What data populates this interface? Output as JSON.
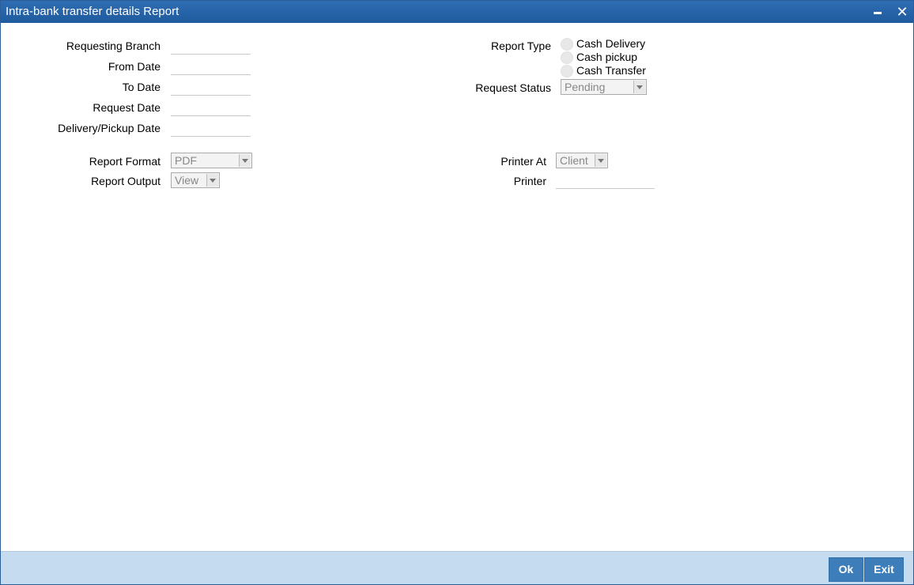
{
  "window": {
    "title": "Intra-bank transfer details Report",
    "minimize_label": "",
    "close_label": "✕"
  },
  "form": {
    "requesting_branch": {
      "label": "Requesting Branch",
      "value": ""
    },
    "from_date": {
      "label": "From Date",
      "value": ""
    },
    "to_date": {
      "label": "To Date",
      "value": ""
    },
    "request_date": {
      "label": "Request Date",
      "value": ""
    },
    "delivery_pickup_date": {
      "label": "Delivery/Pickup Date",
      "value": ""
    },
    "report_type": {
      "label": "Report Type",
      "options": [
        "Cash Delivery",
        "Cash pickup",
        "Cash Transfer"
      ]
    },
    "request_status": {
      "label": "Request Status",
      "value": "Pending"
    },
    "report_format": {
      "label": "Report Format",
      "value": "PDF"
    },
    "report_output": {
      "label": "Report Output",
      "value": "View"
    },
    "printer_at": {
      "label": "Printer At",
      "value": "Client"
    },
    "printer": {
      "label": "Printer",
      "value": ""
    }
  },
  "footer": {
    "ok_label": "Ok",
    "exit_label": "Exit"
  },
  "colors": {
    "titlebar": "#2f6db2",
    "footer": "#c5dcf0",
    "button": "#3d7db9"
  }
}
